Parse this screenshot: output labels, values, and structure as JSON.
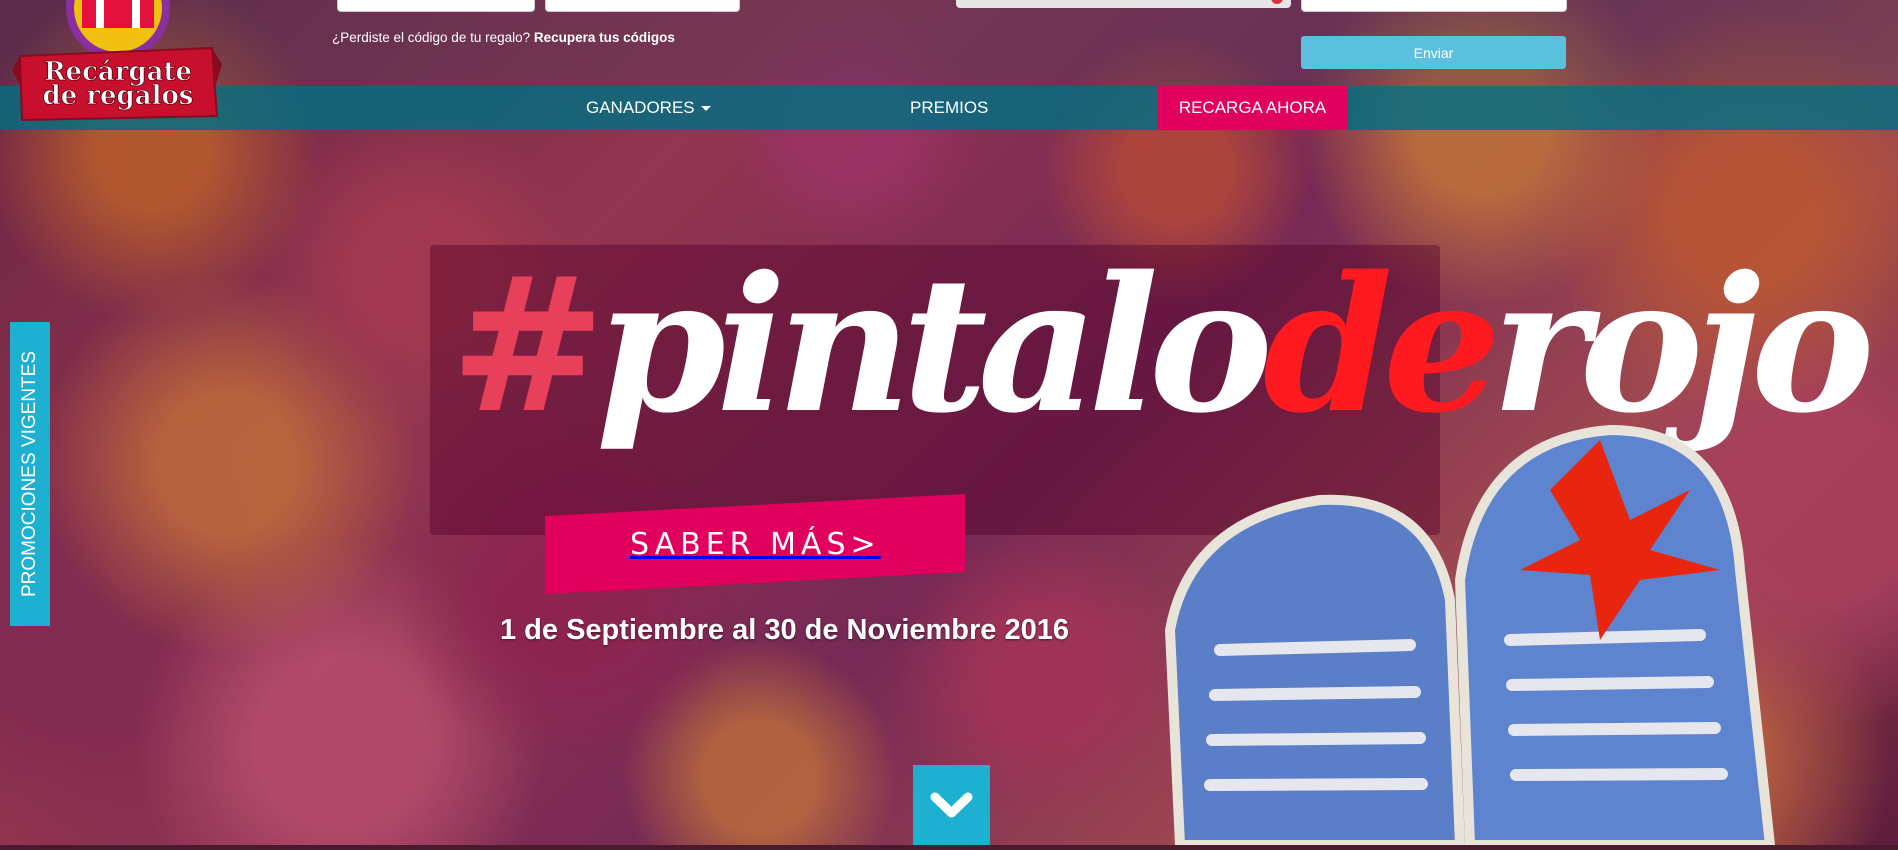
{
  "header": {
    "lost_code_text": "¿Perdiste el código de tu regalo?",
    "recover_link": "Recupera tus códigos",
    "send_label": "Enviar"
  },
  "logo": {
    "line1": "Recárgate",
    "line2": "de regalos"
  },
  "nav": {
    "ganadores": "GANADORES",
    "premios": "PREMIOS",
    "recarga": "RECARGA AHORA"
  },
  "banner": {
    "hashtag_hash": "#",
    "hashtag_pintalo": "pintalo",
    "hashtag_de": "de",
    "hashtag_rojo": "rojo",
    "cta_label": "SABER MÁS>",
    "dates": "1 de Septiembre al 30 de Noviembre 2016"
  },
  "side_tab": {
    "label": "PROMOCIONES VIGENTES"
  },
  "colors": {
    "nav_bg": "#006e82",
    "accent_pink": "#e2005e",
    "cyan": "#1eb0d0",
    "send_button": "#5bc0de",
    "hashtag_red": "#ff1a20"
  },
  "icons": {
    "scroll_down": "chevron-down-icon",
    "ganadores_caret": "caret-down-icon"
  }
}
